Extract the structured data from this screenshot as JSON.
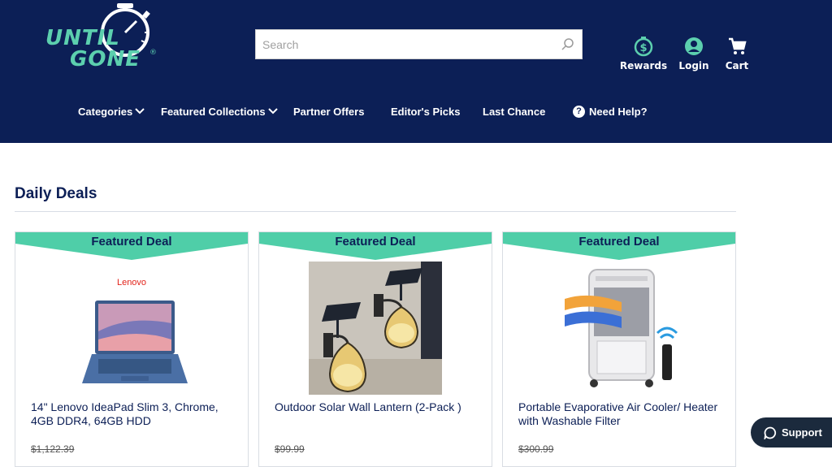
{
  "header": {
    "logo": {
      "line1": "UNTIL",
      "line2": "GONE",
      "reg": "®"
    },
    "search": {
      "placeholder": "Search",
      "value": ""
    },
    "actions": [
      {
        "label": "Rewards",
        "icon": "dollar-circle-icon"
      },
      {
        "label": "Login",
        "icon": "user-circle-icon"
      },
      {
        "label": "Cart",
        "icon": "cart-icon"
      }
    ],
    "nav": [
      {
        "label": "Categories",
        "has_dropdown": true
      },
      {
        "label": "Featured Collections",
        "has_dropdown": true
      },
      {
        "label": "Partner Offers",
        "has_dropdown": false
      },
      {
        "label": "Editor's Picks",
        "has_dropdown": false
      },
      {
        "label": "Last Chance",
        "has_dropdown": false
      },
      {
        "label": "Need Help?",
        "icon": "question-circle-icon"
      }
    ]
  },
  "main": {
    "section_title": "Daily Deals",
    "cards": [
      {
        "ribbon": "Featured Deal",
        "brand": "Lenovo",
        "title": "14\" Lenovo IdeaPad Slim 3, Chrome, 4GB DDR4, 64GB HDD",
        "price": "$1,122.39"
      },
      {
        "ribbon": "Featured Deal",
        "title": "Outdoor Solar Wall Lantern (2-Pack )",
        "price": "$99.99"
      },
      {
        "ribbon": "Featured Deal",
        "title": "Portable Evaporative Air Cooler/ Heater with Washable Filter",
        "price": "$300.99"
      }
    ]
  },
  "support": {
    "label": "Support"
  },
  "colors": {
    "navy": "#0c1f56",
    "teal": "#5ccfae",
    "ribbon": "#4fcea8"
  }
}
